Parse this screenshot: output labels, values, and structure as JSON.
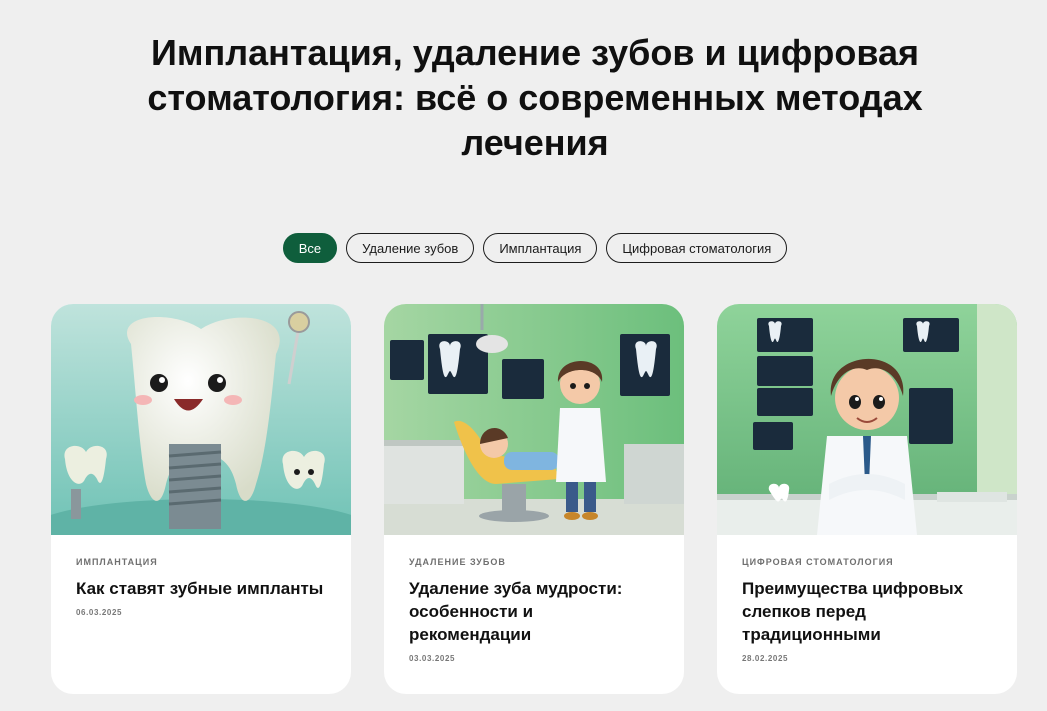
{
  "page": {
    "title": "Имплантация, удаление зубов и цифровая стоматология: всё о современных методах лечения"
  },
  "filters": [
    {
      "label": "Все",
      "active": true
    },
    {
      "label": "Удаление зубов",
      "active": false
    },
    {
      "label": "Имплантация",
      "active": false
    },
    {
      "label": "Цифровая стоматология",
      "active": false
    }
  ],
  "colors": {
    "accent": "#0f5e3c",
    "background": "#efefef",
    "card": "#ffffff"
  },
  "cards": [
    {
      "category": "ИМПЛАНТАЦИЯ",
      "title": "Как ставят зубные импланты",
      "date": "06.03.2025",
      "image": "tooth-mascot-implant-illustration"
    },
    {
      "category": "УДАЛЕНИЕ ЗУБОВ",
      "title": "Удаление зуба мудрости: особенности и рекомендации",
      "date": "03.03.2025",
      "image": "dentist-office-patient-illustration"
    },
    {
      "category": "ЦИФРОВАЯ СТОМАТОЛОГИЯ",
      "title": "Преимущества цифровых слепков перед традиционными",
      "date": "28.02.2025",
      "image": "young-dentist-digital-lab-illustration"
    }
  ]
}
